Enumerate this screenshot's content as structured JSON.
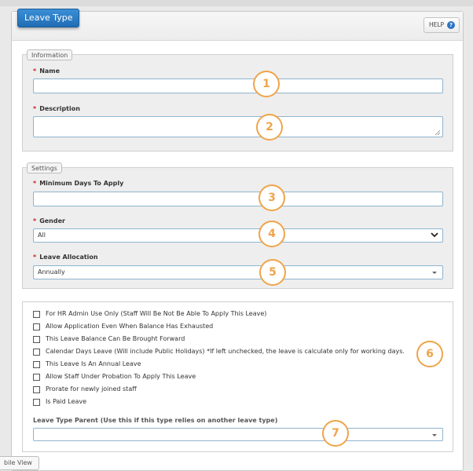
{
  "header": {
    "title": "Leave Type",
    "help_label": "HELP",
    "help_icon": "?"
  },
  "information": {
    "legend": "Information",
    "name_label": "Name",
    "name_value": "",
    "description_label": "Description",
    "description_value": ""
  },
  "settings": {
    "legend": "Settings",
    "min_days_label": "Minimum Days To Apply",
    "min_days_value": "",
    "gender_label": "Gender",
    "gender_value": "All",
    "allocation_label": "Leave Allocation",
    "allocation_value": "Annually"
  },
  "required_marker": "*",
  "options": [
    {
      "label": "For HR Admin Use Only (Staff Will Be Not Be Able To Apply This Leave)",
      "checked": false
    },
    {
      "label": "Allow Application Even When Balance Has Exhausted",
      "checked": false
    },
    {
      "label": "This Leave Balance Can Be Brought Forward",
      "checked": false
    },
    {
      "label": "Calendar Days Leave (Will include Public Holidays) *If left unchecked, the leave is calculate only for working days.",
      "checked": false
    },
    {
      "label": "This Leave Is An Annual Leave",
      "checked": false
    },
    {
      "label": "Allow Staff Under Probation To Apply This Leave",
      "checked": false
    },
    {
      "label": "Prorate for newly joined staff",
      "checked": false
    },
    {
      "label": "Is Paid Leave",
      "checked": false
    }
  ],
  "parent": {
    "label": "Leave Type Parent (Use this if this type relies on another leave type)",
    "value": ""
  },
  "markers": [
    "1",
    "2",
    "3",
    "4",
    "5",
    "6",
    "7"
  ],
  "footer": {
    "mobile_view": "bile View"
  },
  "colors": {
    "title_badge": "#2a7fc8",
    "marker": "#f0a44a",
    "required": "#d02020",
    "input_border": "#8fb4cf"
  }
}
